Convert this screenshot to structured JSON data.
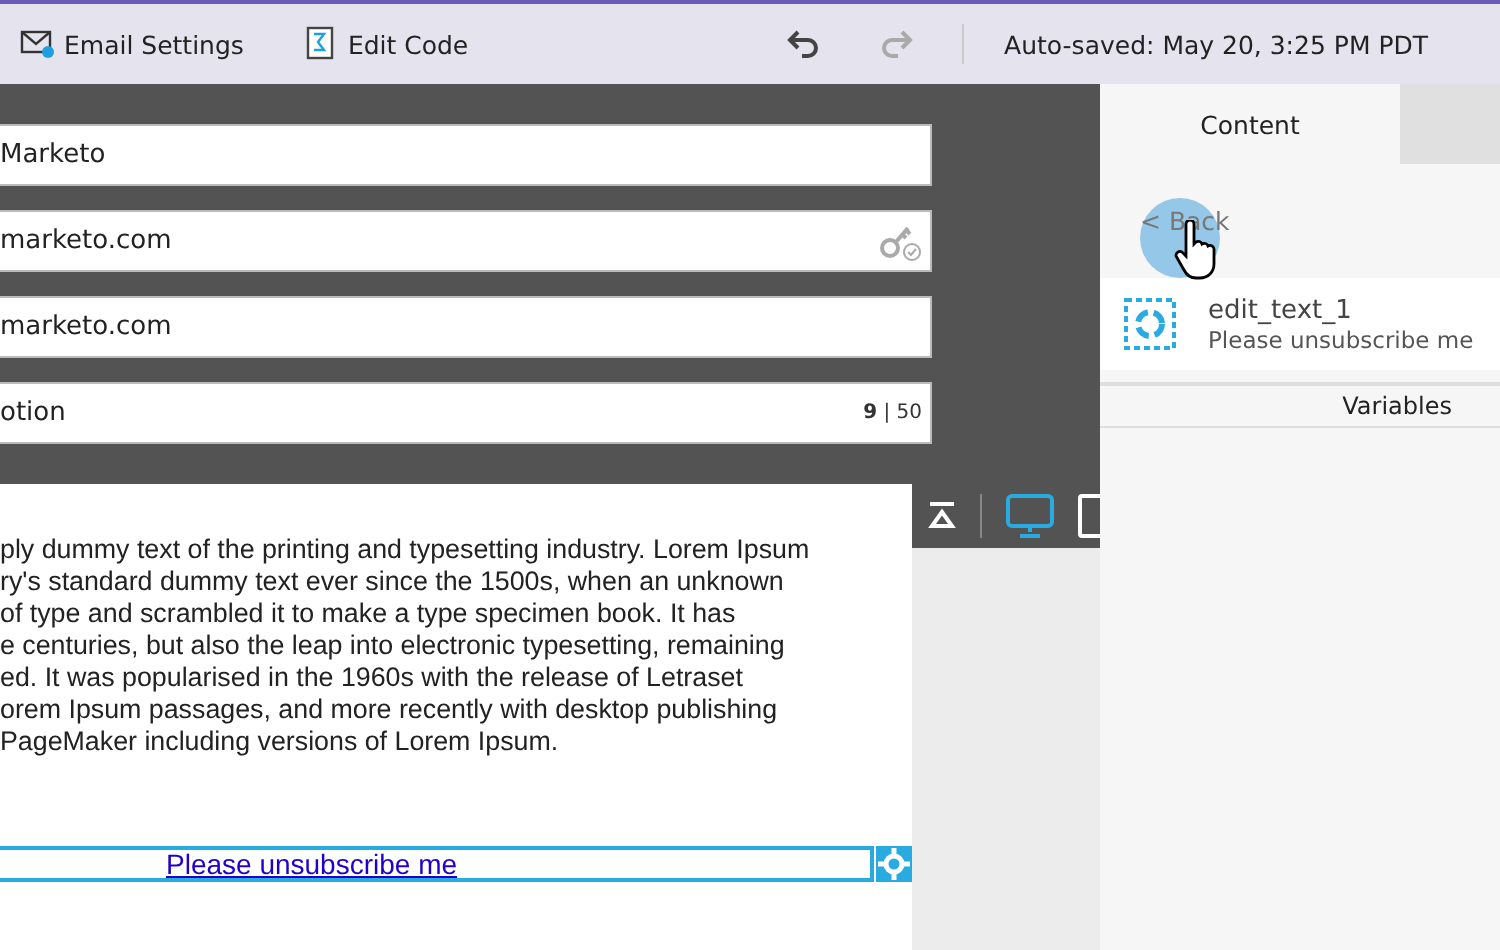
{
  "toolbar": {
    "buttons": [
      {
        "label": "Email Settings",
        "kind": "email"
      },
      {
        "label": "Edit Code",
        "kind": "code"
      }
    ],
    "undo": {
      "disabled": false
    },
    "redo": {
      "disabled": true
    },
    "autosave": "Auto-saved: May 20, 3:25 PM PDT"
  },
  "fields": [
    {
      "value": "Marketo",
      "kind": "text"
    },
    {
      "value": "marketo.com",
      "kind": "key"
    },
    {
      "value": "marketo.com",
      "kind": "text"
    },
    {
      "value": "otion",
      "kind": "counter",
      "counter": "**9** | 50"
    }
  ],
  "preview": {
    "lines": [
      "ply dummy text of the printing and typesetting industry. Lorem Ipsum",
      "ry's standard dummy text ever since the 1500s, when an unknown",
      "of type and scrambled it to make a type specimen book. It has",
      "e centuries, but also the leap into electronic typesetting, remaining",
      "ed. It was popularised in the 1960s with the release of Letraset",
      "orem Ipsum passages, and more recently with desktop publishing",
      "PageMaker including versions of Lorem Ipsum."
    ],
    "link": "Please unsubscribe me"
  },
  "device_toolbar": [
    {
      "kind": "collapse",
      "selected": false
    },
    {
      "kind": "desktop",
      "selected": true
    },
    {
      "kind": "mobile",
      "selected": false
    }
  ],
  "panel": {
    "tabs": [
      {
        "label": "Content",
        "selected": true
      },
      {
        "selected": false
      }
    ],
    "back": "< Back",
    "item": {
      "title": "edit_text_1",
      "subtitle": "Please unsubscribe me"
    },
    "section": "Variables"
  }
}
